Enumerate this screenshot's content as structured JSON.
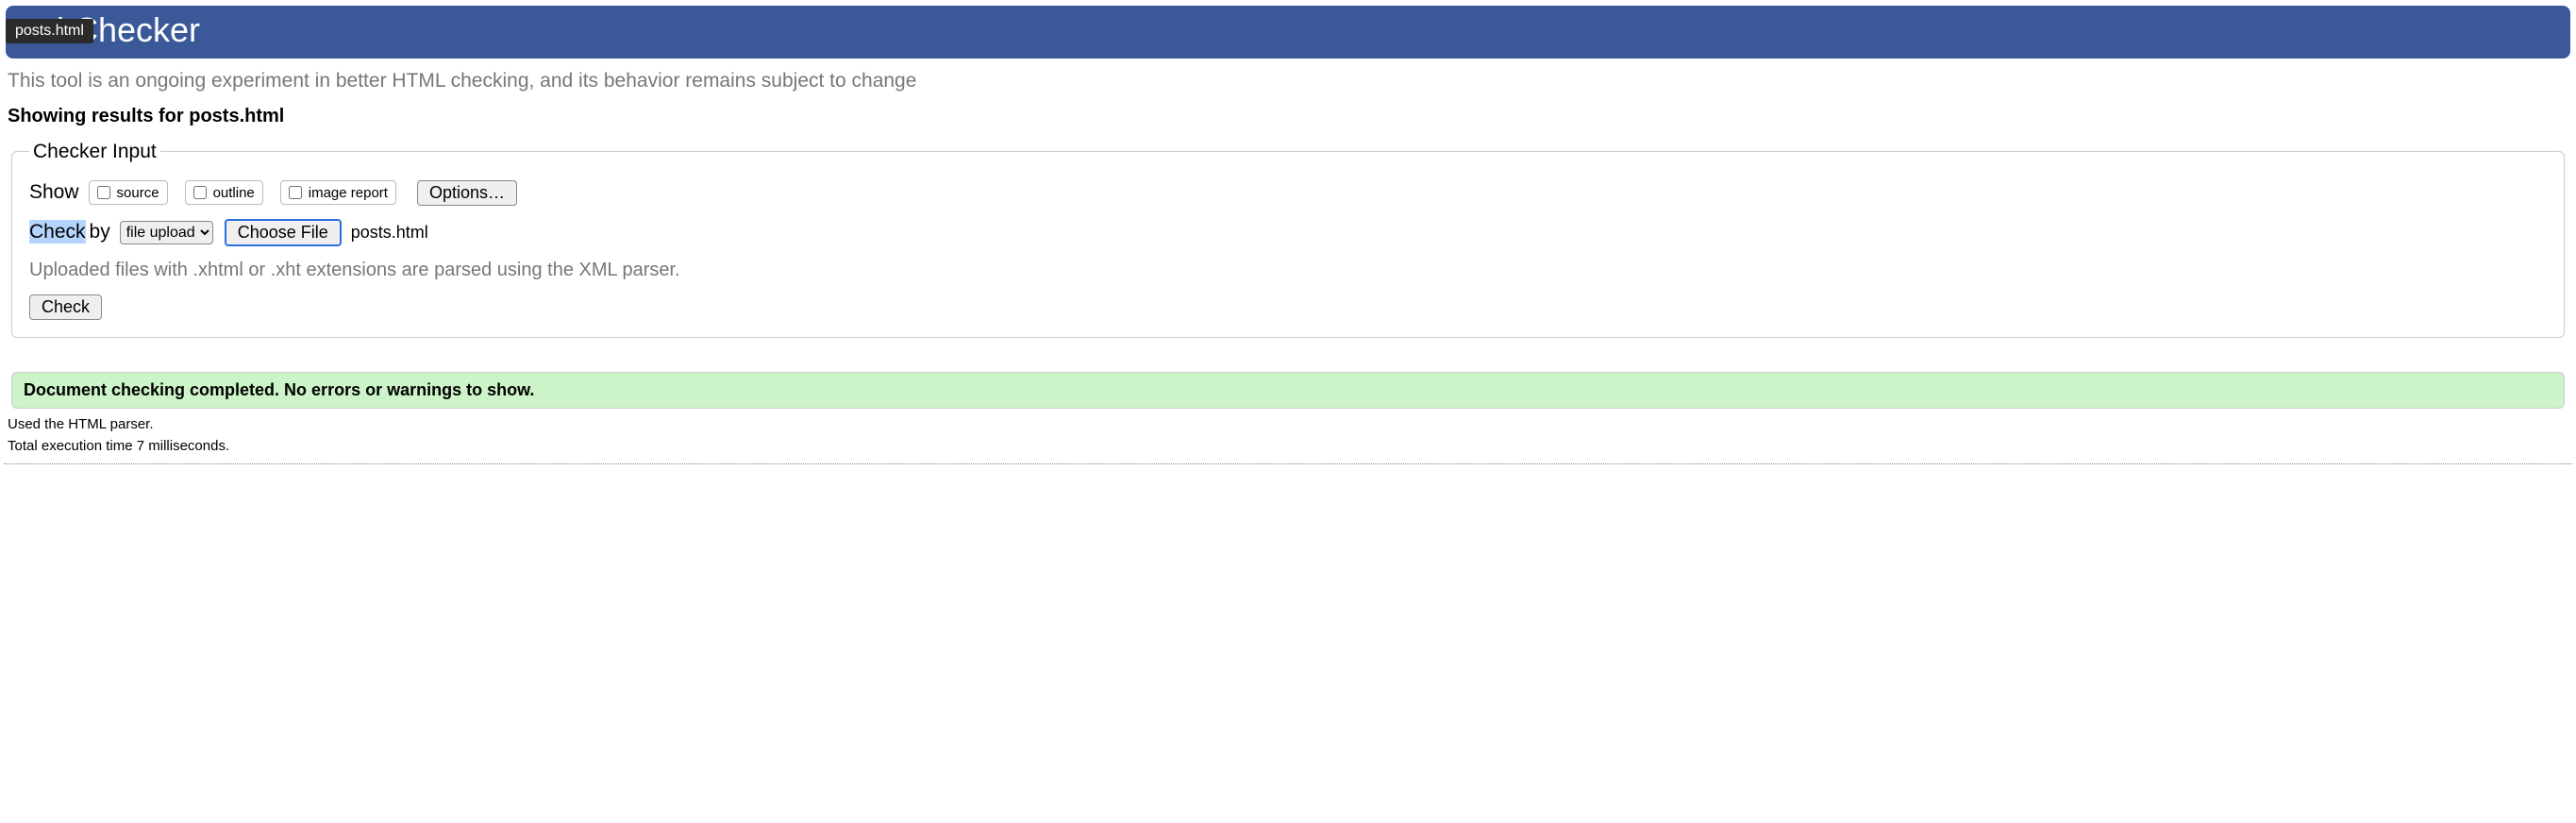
{
  "tab_label": "posts.html",
  "header": {
    "title_suffix": "tml Checker"
  },
  "subhead": "This tool is an ongoing experiment in better HTML checking, and its behavior remains subject to change",
  "results_heading_prefix": "Showing results for ",
  "results_heading_file": "posts.html",
  "checker_input": {
    "legend": "Checker Input",
    "show_label": "Show",
    "checkboxes": {
      "source": "source",
      "outline": "outline",
      "image_report": "image report"
    },
    "options_button": "Options…",
    "check_label": "Check",
    "by_label": "by",
    "mode_selected": "file upload",
    "mode_caret": " ⌄",
    "choose_file_button": "Choose File",
    "chosen_filename": "posts.html",
    "xml_note": "Uploaded files with .xhtml or .xht extensions are parsed using the XML parser.",
    "check_button": "Check"
  },
  "success_message": "Document checking completed. No errors or warnings to show.",
  "parser_line": "Used the HTML parser.",
  "time_line": "Total execution time 7 milliseconds."
}
